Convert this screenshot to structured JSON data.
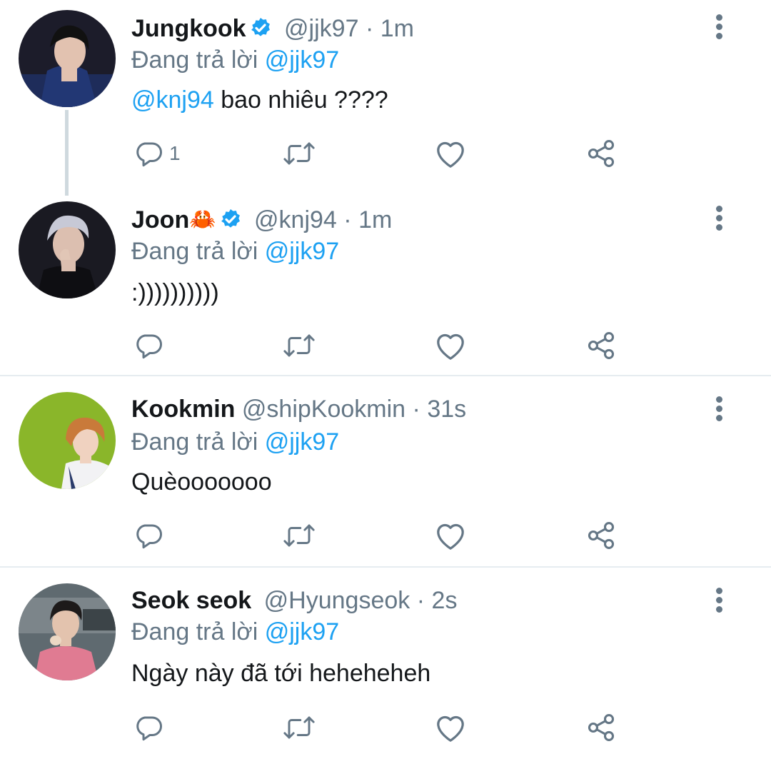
{
  "colors": {
    "link": "#1da1f2",
    "muted": "#657786",
    "text": "#14171a",
    "divider": "#e6ecf0"
  },
  "icons": [
    "reply-icon",
    "retweet-icon",
    "like-icon",
    "share-icon",
    "more-icon",
    "verified-badge-icon",
    "crab-emoji"
  ],
  "tweets": [
    {
      "name": "Jungkook",
      "emoji": "",
      "verified": true,
      "handle": "@jjk97",
      "separator": "·",
      "time": "1m",
      "reply_prefix": "Đang trả lời",
      "reply_to": "@jjk97",
      "mention": "@knj94",
      "text": " bao nhiêu ????",
      "reply_count": "1"
    },
    {
      "name": "Joon",
      "emoji": "🦀",
      "verified": true,
      "handle": "@knj94",
      "separator": "·",
      "time": "1m",
      "reply_prefix": "Đang trả lời",
      "reply_to": "@jjk97",
      "mention": "",
      "text": ":))))))))))",
      "reply_count": ""
    },
    {
      "name": "Kookmin",
      "emoji": "",
      "verified": false,
      "handle": "@shipKookmin",
      "separator": "·",
      "time": "31s",
      "reply_prefix": "Đang trả lời",
      "reply_to": "@jjk97",
      "mention": "",
      "text": "Quèooooooo",
      "reply_count": ""
    },
    {
      "name": "Seok seok",
      "emoji": "",
      "verified": false,
      "handle": "@Hyungseok",
      "separator": "·",
      "time": "2s",
      "reply_prefix": "Đang trả lời",
      "reply_to": "@jjk97",
      "mention": "",
      "text": "Ngày này đã tới heheheheh",
      "reply_count": ""
    }
  ]
}
